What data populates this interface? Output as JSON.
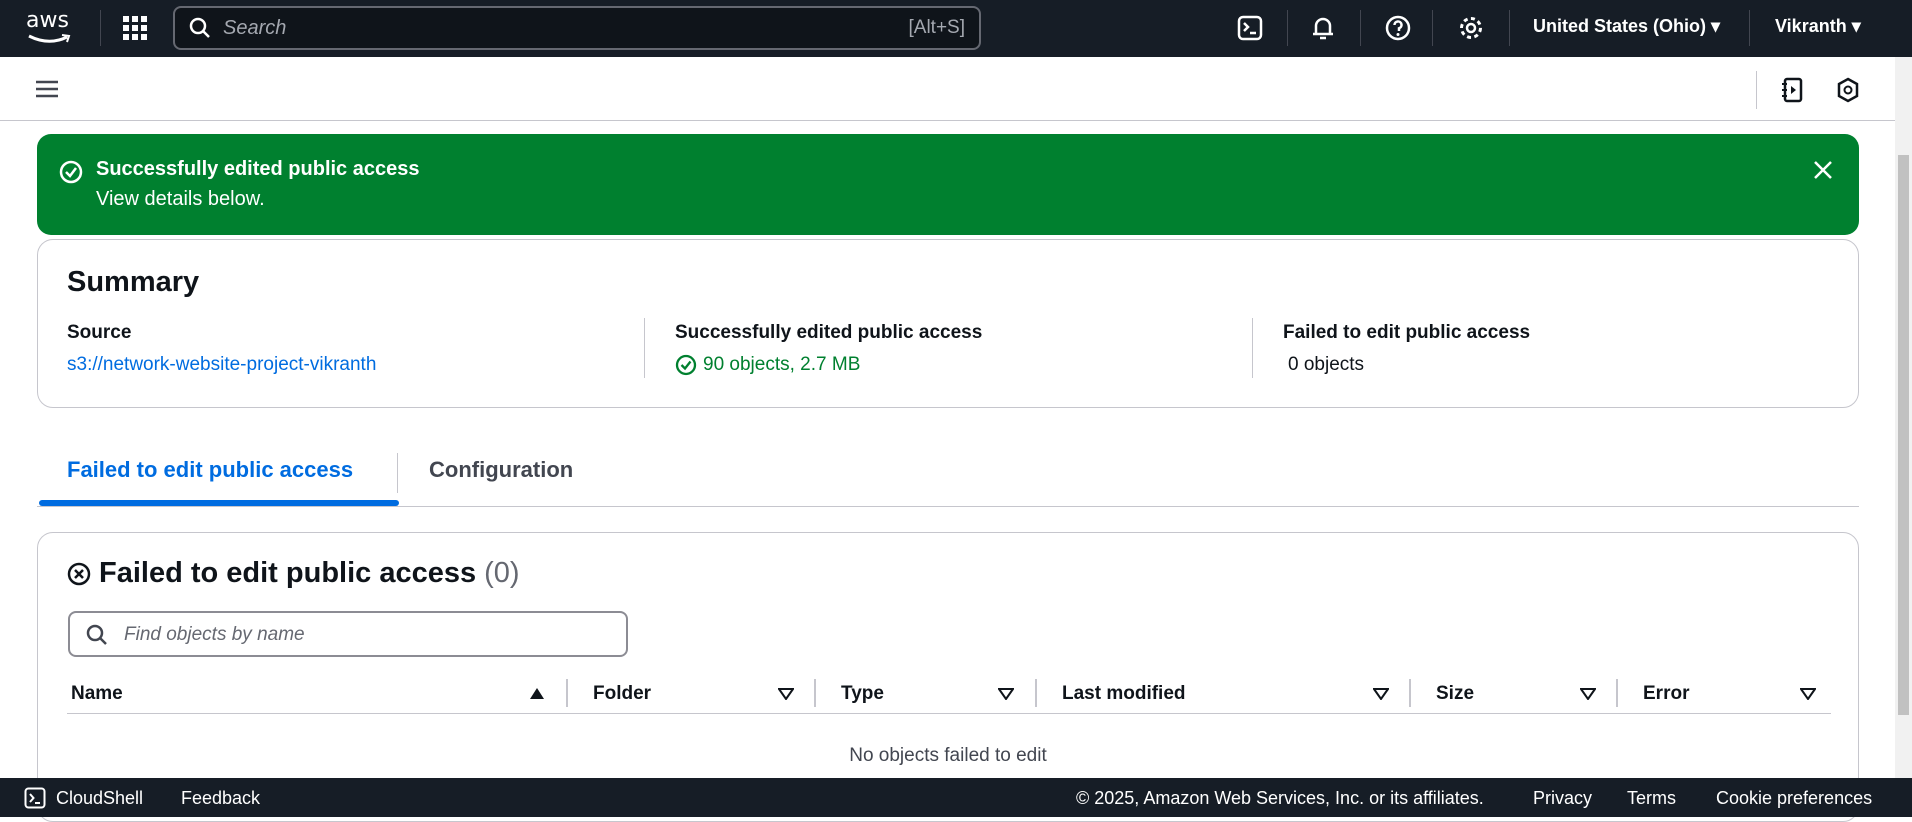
{
  "topnav": {
    "logo": "aws",
    "search_placeholder": "Search",
    "search_shortcut": "[Alt+S]",
    "region": "United States (Ohio)",
    "user": "Vikranth",
    "icons": [
      "cloudshell-icon",
      "bell-icon",
      "help-icon",
      "gear-icon"
    ]
  },
  "flash": {
    "title": "Successfully edited public access",
    "message": "View details below.",
    "color": "#00802f"
  },
  "summary": {
    "title": "Summary",
    "source_label": "Source",
    "source_value": "s3://network-website-project-vikranth",
    "success_label": "Successfully edited public access",
    "success_value": "90 objects, 2.7 MB",
    "failed_label": "Failed to edit public access",
    "failed_value": "0 objects"
  },
  "tabs": [
    {
      "label": "Failed to edit public access",
      "active": true
    },
    {
      "label": "Configuration",
      "active": false
    }
  ],
  "failed_panel": {
    "title": "Failed to edit public access",
    "count": "(0)",
    "search_placeholder": "Find objects by name",
    "columns": [
      "Name",
      "Folder",
      "Type",
      "Last modified",
      "Size",
      "Error"
    ],
    "empty_text": "No objects failed to edit"
  },
  "footer": {
    "cloudshell": "CloudShell",
    "feedback": "Feedback",
    "copyright": "© 2025, Amazon Web Services, Inc. or its affiliates.",
    "privacy": "Privacy",
    "terms": "Terms",
    "cookie": "Cookie preferences"
  }
}
